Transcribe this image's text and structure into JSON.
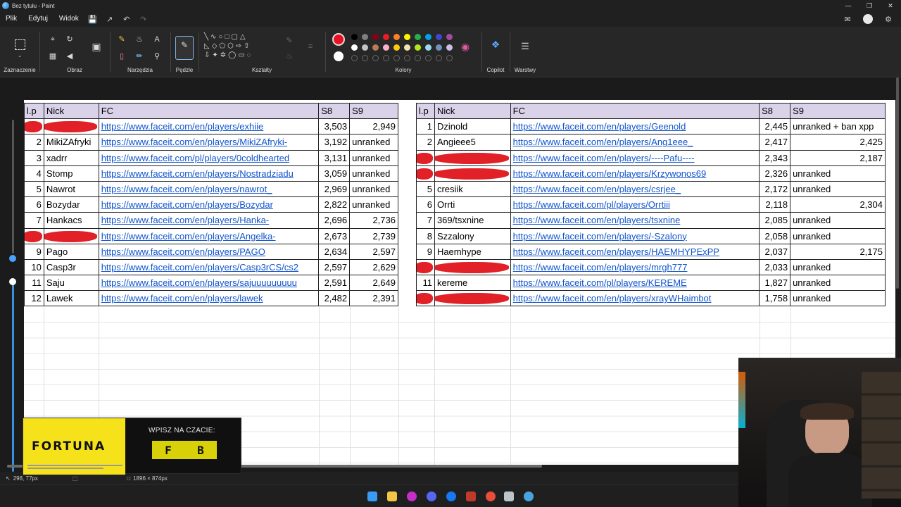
{
  "window": {
    "title": "Bez tytułu - Paint"
  },
  "menu": {
    "file": "Plik",
    "edit": "Edytuj",
    "view": "Widok"
  },
  "ribbon": {
    "selection": "Zaznaczenie",
    "image": "Obraz",
    "tools": "Narzędzia",
    "brushes": "Pędzle",
    "shapes": "Kształty",
    "colors": "Kolory",
    "copilot": "Copilot",
    "layers": "Warstwy"
  },
  "palette": {
    "primary": "#e81123",
    "secondary": "#ffffff",
    "row1": [
      "#000000",
      "#7f7f7f",
      "#880015",
      "#ed1c24",
      "#ff7f27",
      "#fff200",
      "#22b14c",
      "#00a2e8",
      "#3f48cc",
      "#a349a4"
    ],
    "row2": [
      "#ffffff",
      "#c3c3c3",
      "#b97a57",
      "#ffaec9",
      "#ffc90e",
      "#efe4b0",
      "#b5e61d",
      "#99d9ea",
      "#7092be",
      "#c8bfe7"
    ]
  },
  "table_left": {
    "headers": [
      "l.p",
      "Nick",
      "FC",
      "S8",
      "S9"
    ],
    "rows": [
      {
        "lp": "",
        "nick": "",
        "fc": "https://www.faceit.com/en/players/exhiie",
        "s8": "3,503",
        "s9": "2,949",
        "redacted": true
      },
      {
        "lp": "2",
        "nick": "MikiZAfryki",
        "fc": "https://www.faceit.com/en/players/MikiZAfryki-",
        "s8": "3,192",
        "s9": "unranked"
      },
      {
        "lp": "3",
        "nick": "xadrr",
        "fc": "https://www.faceit.com/pl/players/0coldhearted",
        "s8": "3,131",
        "s9": "unranked"
      },
      {
        "lp": "4",
        "nick": "Stomp",
        "fc": "https://www.faceit.com/en/players/Nostradziadu",
        "s8": "3,059",
        "s9": "unranked"
      },
      {
        "lp": "5",
        "nick": "Nawrot",
        "fc": "https://www.faceit.com/en/players/nawrot_",
        "s8": "2,969",
        "s9": "unranked"
      },
      {
        "lp": "6",
        "nick": "Bozydar",
        "fc": "https://www.faceit.com/en/players/Bozydar",
        "s8": "2,822",
        "s9": "unranked"
      },
      {
        "lp": "7",
        "nick": "Hankacs",
        "fc": "https://www.faceit.com/en/players/Hanka-",
        "s8": "2,696",
        "s9": "2,736"
      },
      {
        "lp": "",
        "nick": "",
        "fc": "https://www.faceit.com/en/players/Angelka-",
        "s8": "2,673",
        "s9": "2,739",
        "redacted": true
      },
      {
        "lp": "9",
        "nick": "Pago",
        "fc": "https://www.faceit.com/en/players/PAGO",
        "s8": "2,634",
        "s9": "2,597"
      },
      {
        "lp": "10",
        "nick": "Casp3r",
        "fc": "https://www.faceit.com/en/players/Casp3rCS/cs2",
        "s8": "2,597",
        "s9": "2,629"
      },
      {
        "lp": "11",
        "nick": "Saju",
        "fc": "https://www.faceit.com/en/players/sajuuuuuuuuu",
        "s8": "2,591",
        "s9": "2,649"
      },
      {
        "lp": "12",
        "nick": "Lawek",
        "fc": "https://www.faceit.com/en/players/lawek",
        "s8": "2,482",
        "s9": "2,391"
      }
    ]
  },
  "table_right": {
    "headers": [
      "l.p",
      "Nick",
      "FC",
      "S8",
      "S9"
    ],
    "rows": [
      {
        "lp": "1",
        "nick": "Dzinold",
        "fc": "https://www.faceit.com/en/players/Geenold",
        "s8": "2,445",
        "s9": "unranked + ban xpp"
      },
      {
        "lp": "2",
        "nick": "Angieee5",
        "fc": "https://www.faceit.com/en/players/Ang1eee_",
        "s8": "2,417",
        "s9": "2,425"
      },
      {
        "lp": "",
        "nick": "",
        "fc": "https://www.faceit.com/en/players/----Pafu----",
        "s8": "2,343",
        "s9": "2,187",
        "redacted": true
      },
      {
        "lp": "",
        "nick": "",
        "fc": "https://www.faceit.com/en/players/Krzywonos69",
        "s8": "2,326",
        "s9": "unranked",
        "redacted": true
      },
      {
        "lp": "5",
        "nick": "cresiik",
        "fc": "https://www.faceit.com/en/players/csrjee_",
        "s8": "2,172",
        "s9": "unranked"
      },
      {
        "lp": "6",
        "nick": "Orrti",
        "fc": "https://www.faceit.com/pl/players/Orrtiii",
        "s8": "2,118",
        "s9": "2,304"
      },
      {
        "lp": "7",
        "nick": "369/tsxnine",
        "fc": "https://www.faceit.com/en/players/tsxnine",
        "s8": "2,085",
        "s9": "unranked"
      },
      {
        "lp": "8",
        "nick": "Szzalony",
        "fc": "https://www.faceit.com/en/players/-Szalony",
        "s8": "2,058",
        "s9": "unranked"
      },
      {
        "lp": "9",
        "nick": "Haemhype",
        "fc": "https://www.faceit.com/en/players/HAEMHYPExPP",
        "s8": "2,037",
        "s9": "2,175"
      },
      {
        "lp": "",
        "nick": "",
        "fc": "https://www.faceit.com/en/players/mrgh777",
        "s8": "2,033",
        "s9": "unranked",
        "redacted": true
      },
      {
        "lp": "11",
        "nick": "kereme",
        "fc": "https://www.faceit.com/pl/players/KEREME",
        "s8": "1,827",
        "s9": "unranked"
      },
      {
        "lp": "",
        "nick": "",
        "fc": "https://www.faceit.com/en/players/xrayWHaimbot",
        "s8": "1,758",
        "s9": "unranked",
        "redacted": true
      }
    ]
  },
  "status": {
    "cursor": "298, 77px",
    "canvas_size": "1896 × 874px"
  },
  "ad": {
    "brand": "FORTUNA",
    "cta": "WPISZ NA CZACIE:",
    "code_left": "F",
    "code_right": "B"
  }
}
